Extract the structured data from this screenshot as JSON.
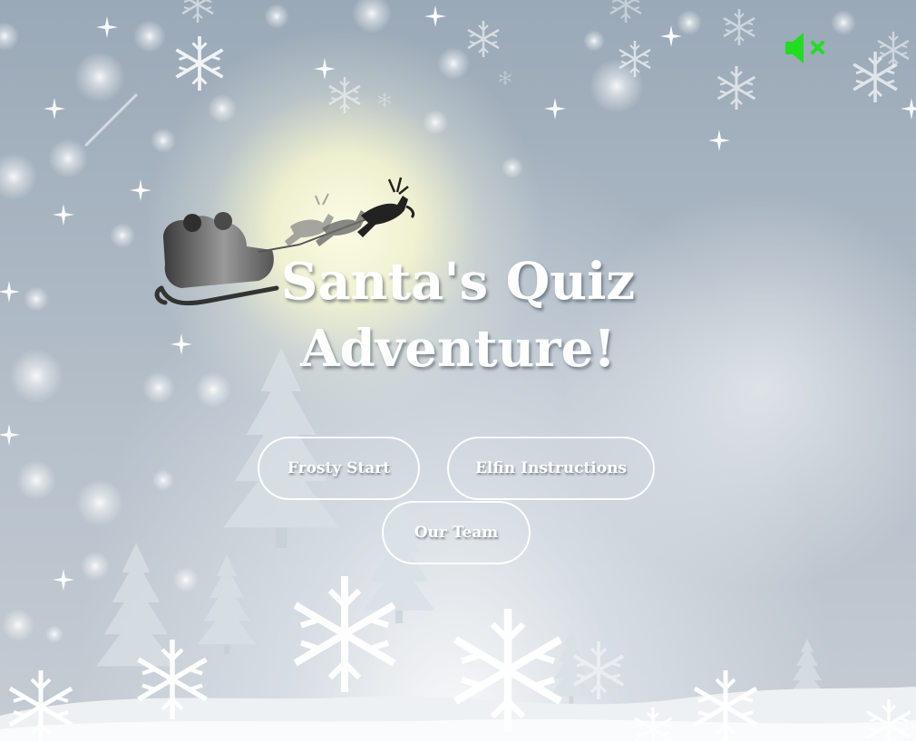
{
  "game": {
    "title_line1": "Santa's Quiz",
    "title_line2": "Adventure!"
  },
  "menu": {
    "start_label": "Frosty Start",
    "instructions_label": "Elfin Instructions",
    "team_label": "Our Team"
  },
  "sound": {
    "icon": "speaker-muted-icon",
    "color": "#22dd22"
  }
}
